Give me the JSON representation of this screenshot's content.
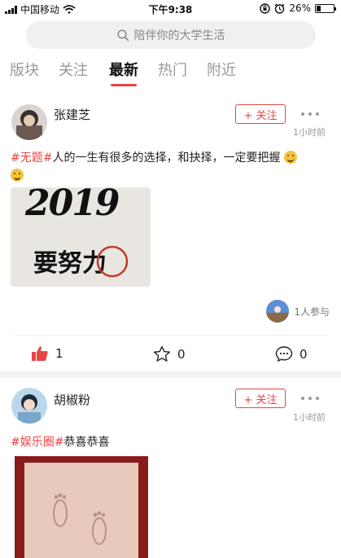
{
  "status_bar": {
    "carrier": "中国移动",
    "time": "下午9:38",
    "battery_text": "26%",
    "battery_level": 0.26,
    "icons": [
      "signal-icon",
      "wifi-icon",
      "orientation-lock-icon",
      "alarm-icon",
      "battery-icon"
    ]
  },
  "search": {
    "placeholder": "陪伴你的大学生活",
    "icon": "search-icon"
  },
  "tabs": [
    {
      "label": "版块",
      "active": false
    },
    {
      "label": "关注",
      "active": false
    },
    {
      "label": "最新",
      "active": true
    },
    {
      "label": "热门",
      "active": false
    },
    {
      "label": "附近",
      "active": false
    }
  ],
  "posts": [
    {
      "username": "张建芝",
      "follow_label": "+ 关注",
      "time": "1小时前",
      "tag": "#无题#",
      "text": "人的一生有很多的选择，和抉择，一定要把握",
      "image_text_top": "2019",
      "image_text_bottom": "要努力",
      "participants": "1人参与",
      "actions": {
        "likes": "1",
        "favorites": "0",
        "comments": "0"
      }
    },
    {
      "username": "胡椒粉",
      "follow_label": "+ 关注",
      "time": "1小时前",
      "tag": "#娱乐圈#",
      "text": "恭喜恭喜"
    }
  ],
  "colors": {
    "accent": "#e84545",
    "muted": "#999999",
    "background": "#ffffff"
  }
}
